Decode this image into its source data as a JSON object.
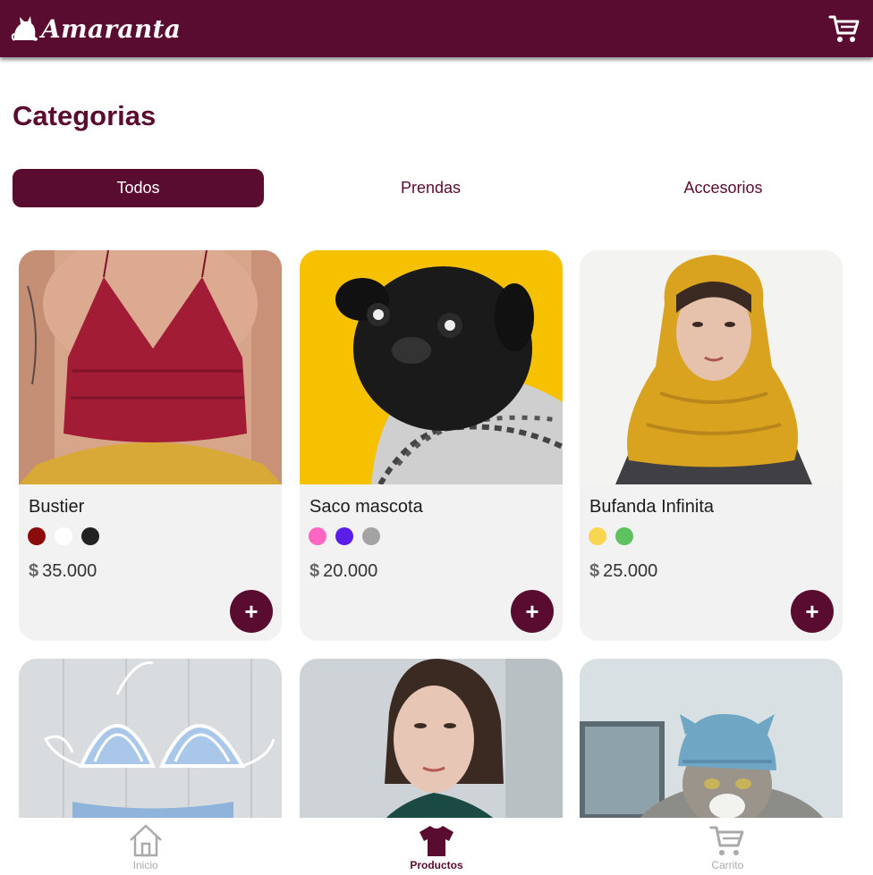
{
  "header": {
    "brand_name": "Amaranta",
    "logo_icon": "cat-icon",
    "cart_icon": "cart-icon"
  },
  "section": {
    "title": "Categorias"
  },
  "tabs": [
    {
      "label": "Todos",
      "active": true
    },
    {
      "label": "Prendas",
      "active": false
    },
    {
      "label": "Accesorios",
      "active": false
    }
  ],
  "products": [
    {
      "name": "Bustier",
      "price_currency": "$",
      "price": "35.000",
      "colors": [
        "#8b0a0a",
        "#ffffff",
        "#222222"
      ],
      "add_label": "+"
    },
    {
      "name": "Saco mascota",
      "price_currency": "$",
      "price": "20.000",
      "colors": [
        "#ff66c4",
        "#5b1ee8",
        "#a3a3a3"
      ],
      "add_label": "+"
    },
    {
      "name": "Bufanda Infinita",
      "price_currency": "$",
      "price": "25.000",
      "colors": [
        "#f7d654",
        "#5ec35e"
      ],
      "add_label": "+"
    },
    {
      "name": "",
      "price_currency": "",
      "price": "",
      "colors": [],
      "add_label": ""
    },
    {
      "name": "",
      "price_currency": "",
      "price": "",
      "colors": [],
      "add_label": ""
    },
    {
      "name": "",
      "price_currency": "",
      "price": "",
      "colors": [],
      "add_label": ""
    }
  ],
  "bottom_nav": [
    {
      "label": "Inicio",
      "icon": "home-icon",
      "active": false
    },
    {
      "label": "Productos",
      "icon": "shirt-icon",
      "active": true
    },
    {
      "label": "Carrito",
      "icon": "cart-icon",
      "active": false
    }
  ],
  "colors": {
    "brand": "#5a0b30",
    "card_bg": "#f2f2f2"
  }
}
